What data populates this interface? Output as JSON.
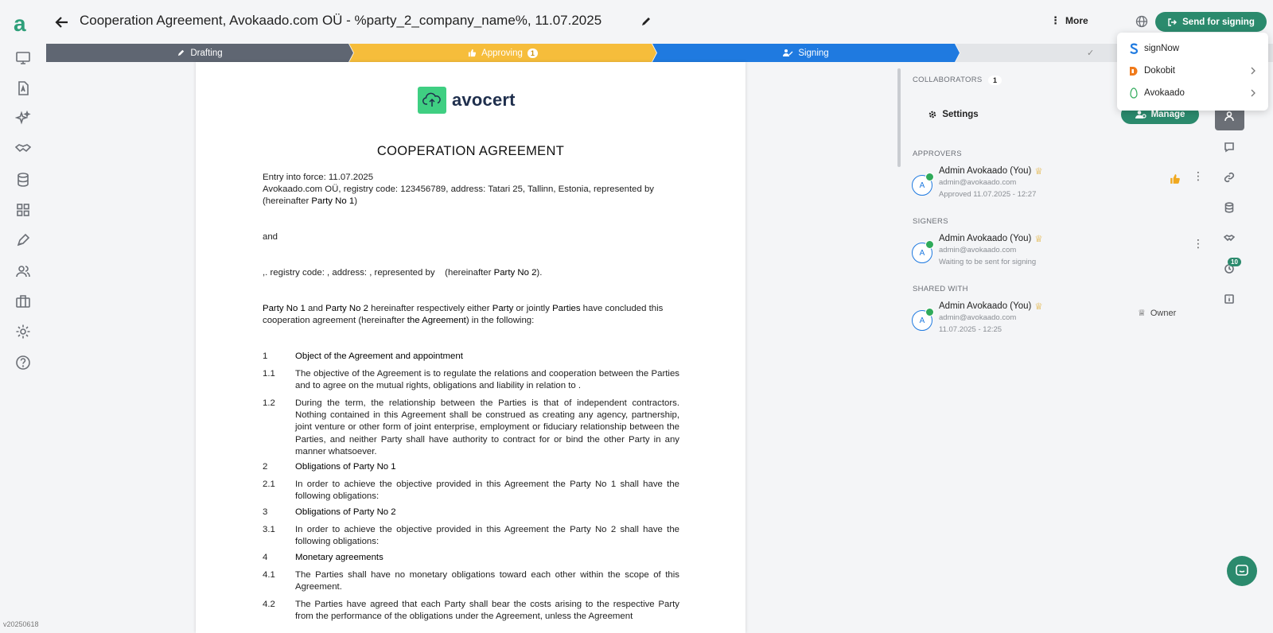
{
  "app": {
    "logo": "a",
    "version": "v20250618"
  },
  "header": {
    "title": "Cooperation Agreement, Avokaado.com OÜ - %party_2_company_name%, 11.07.2025",
    "more_label": "More",
    "send_label": "Send for signing"
  },
  "stepper": {
    "steps": [
      {
        "label": "Drafting"
      },
      {
        "label": "Approving",
        "badge": "1"
      },
      {
        "label": "Signing"
      },
      {
        "label": ""
      }
    ]
  },
  "signing_menu": {
    "items": [
      {
        "label": "signNow"
      },
      {
        "label": "Dokobit"
      },
      {
        "label": "Avokaado"
      }
    ]
  },
  "document": {
    "logo_text": "avocert",
    "title": "COOPERATION AGREEMENT",
    "entry_line": "Entry into force: 11.07.2025",
    "party1_line": "Avokaado.com OÜ, registry code: 123456789, address: Tatari 25, Tallinn, Estonia, represented by",
    "party1_line2_pre": "(hereinafter ",
    "party1_name": "Party No 1",
    "party1_line2_post": ")",
    "and": "and",
    "party2_pre": ",. registry code: , address: , represented by    (hereinafter ",
    "party2_name": "Party No 2",
    "party2_post": ").",
    "intro_1": "Party No 1",
    "intro_2": " and ",
    "intro_3": "Party No 2",
    "intro_4": " hereinafter respectively either ",
    "intro_5": "Party",
    "intro_6": " or jointly ",
    "intro_7": "Parties",
    "intro_8": " have concluded this",
    "intro_line2_pre": "cooperation agreement (hereinafter ",
    "intro_line2_bold": "the Agreement",
    "intro_line2_post": ") in the following:",
    "clauses": [
      {
        "num": "1",
        "text": "Object of the Agreement and appointment"
      },
      {
        "num": "1.1",
        "text": "The objective of the Agreement is to regulate the relations and cooperation between the Parties and to agree on the mutual rights, obligations and liability in relation to ."
      },
      {
        "num": "1.2",
        "text": "During the term, the relationship between the Parties is that of independent contractors. Nothing contained in this Agreement shall be construed as creating any agency, partnership, joint venture or other form of joint enterprise, employment or fiduciary relationship between the Parties, and neither Party shall have authority to contract for or bind the other Party in any manner whatsoever."
      },
      {
        "num": "2",
        "text": "Obligations of Party No 1"
      },
      {
        "num": "2.1",
        "text": "In order to achieve the objective provided in this Agreement the Party No 1 shall have the following obligations:"
      },
      {
        "num": "3",
        "text": "Obligations of Party No 2"
      },
      {
        "num": "3.1",
        "text": "In order to achieve the objective provided in this Agreement the Party No 2 shall have the following obligations:"
      },
      {
        "num": "4",
        "text": "Monetary agreements"
      },
      {
        "num": "4.1",
        "text": "The Parties shall have no monetary obligations toward each other within the scope of this Agreement."
      },
      {
        "num": "4.2",
        "text": "The Parties have agreed that each Party shall bear the costs arising to the respective Party from the performance of the obligations under the Agreement, unless the Agreement"
      }
    ]
  },
  "panel": {
    "collaborators_label": "COLLABORATORS",
    "collaborators_count": "1",
    "settings_label": "Settings",
    "manage_label": "Manage",
    "approvers_label": "APPROVERS",
    "signers_label": "SIGNERS",
    "shared_label": "SHARED WITH",
    "approver": {
      "initial": "A",
      "name": "Admin Avokaado (You)",
      "email": "admin@avokaado.com",
      "status": "Approved 11.07.2025 - 12:27"
    },
    "signer": {
      "initial": "A",
      "name": "Admin Avokaado (You)",
      "email": "admin@avokaado.com",
      "status": "Waiting to be sent for signing"
    },
    "shared": {
      "initial": "A",
      "name": "Admin Avokaado (You)",
      "email": "admin@avokaado.com",
      "status": "11.07.2025 - 12:25",
      "role": "Owner"
    }
  },
  "right_rail": {
    "count_badge": "10"
  },
  "colors": {
    "brand": "#2b8a6d",
    "drafting": "#5f6672",
    "approving": "#f6bd3b",
    "signing": "#1f7ae0",
    "crown": "#e0a825"
  }
}
